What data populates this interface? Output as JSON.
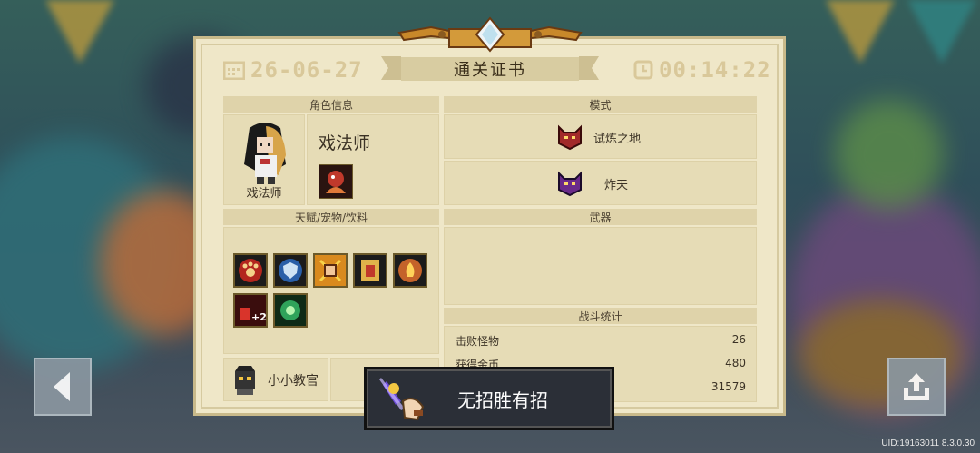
{
  "certificate": {
    "date": "26-06-27",
    "title": "通关证书",
    "time": "00:14:22"
  },
  "character": {
    "header": "角色信息",
    "name": "戏法师",
    "portrait_label": "戏法师"
  },
  "mode": {
    "header": "模式",
    "items": [
      "试炼之地",
      "炸天"
    ]
  },
  "talents": {
    "header": "天赋/宠物/饮料",
    "pet_name": "小小教官"
  },
  "weapon": {
    "header": "武器"
  },
  "battle_stats": {
    "header": "战斗统计",
    "rows": [
      {
        "label": "击败怪物",
        "value": "26"
      },
      {
        "label": "获得金币",
        "value": "480"
      },
      {
        "label": "",
        "value": "31579"
      }
    ]
  },
  "toast": {
    "text": "无招胜有招"
  },
  "footer": {
    "uid": "UID:19163011 8.3.0.30"
  },
  "colors": {
    "paper": "#efe7c8",
    "gold": "#d9c89a",
    "toast_bg": "#2b2f37"
  }
}
